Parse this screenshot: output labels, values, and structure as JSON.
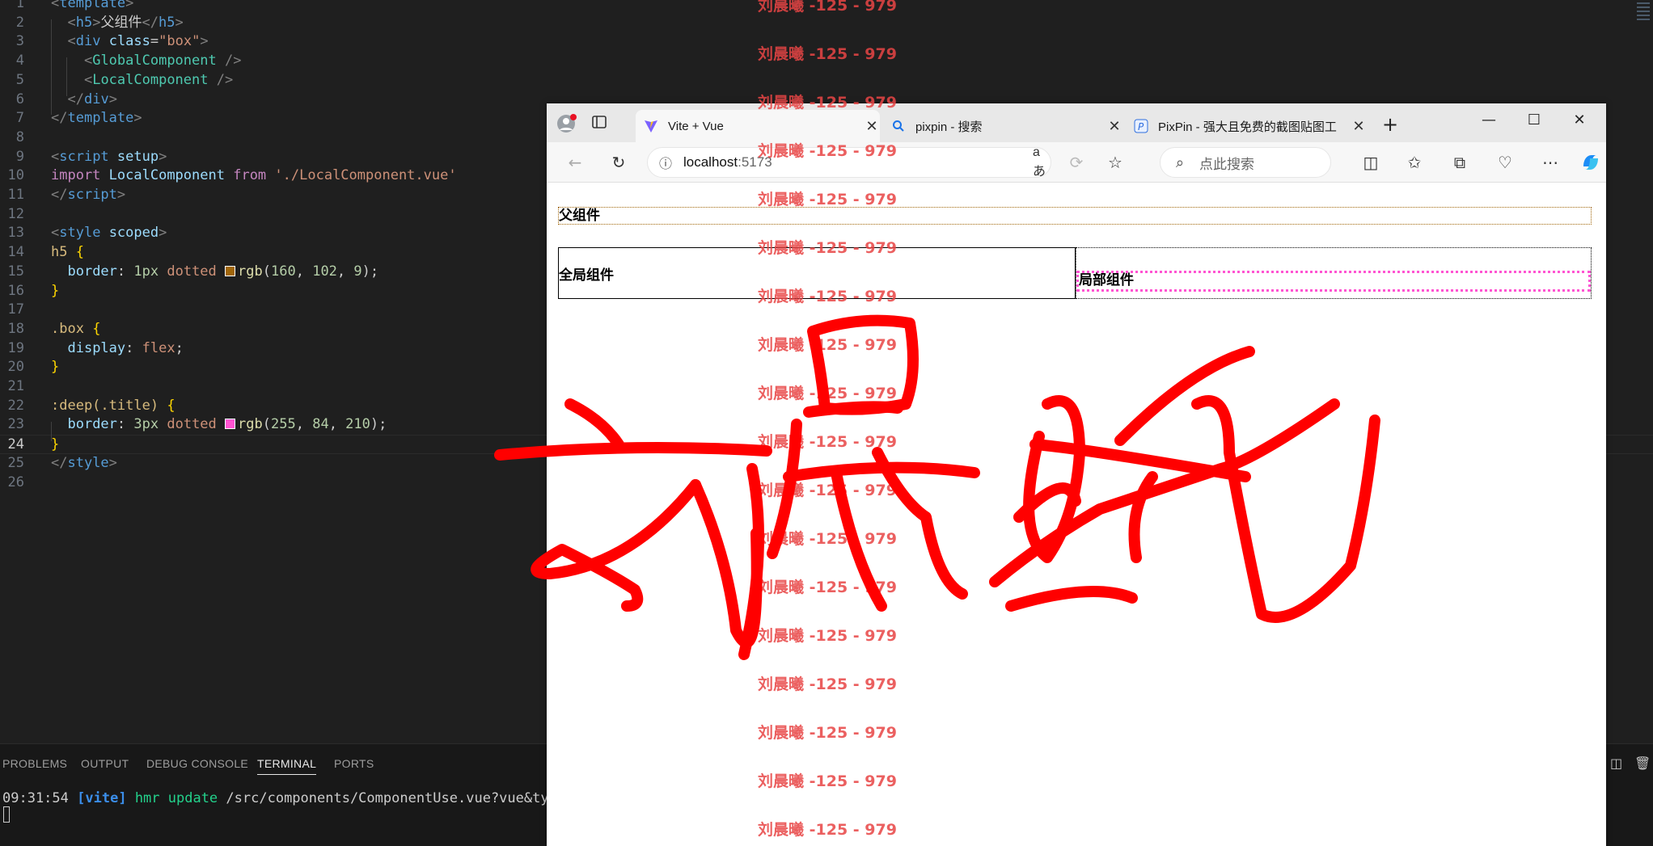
{
  "editor": {
    "lines": [
      {
        "n": "1",
        "html": [
          [
            "t-br",
            "<"
          ],
          [
            "t-tag",
            "template"
          ],
          [
            "t-br",
            ">"
          ]
        ]
      },
      {
        "n": "2",
        "html": [
          [
            "t-plain",
            "  "
          ],
          [
            "t-br",
            "<"
          ],
          [
            "t-tag",
            "h5"
          ],
          [
            "t-br",
            ">"
          ],
          [
            "t-plain",
            "父组件"
          ],
          [
            "t-br",
            "</"
          ],
          [
            "t-tag",
            "h5"
          ],
          [
            "t-br",
            ">"
          ]
        ]
      },
      {
        "n": "3",
        "html": [
          [
            "t-plain",
            "  "
          ],
          [
            "t-br",
            "<"
          ],
          [
            "t-tag",
            "div"
          ],
          [
            "t-plain",
            " "
          ],
          [
            "t-attr",
            "class"
          ],
          [
            "t-plain",
            "="
          ],
          [
            "t-str",
            "\"box\""
          ],
          [
            "t-br",
            ">"
          ]
        ]
      },
      {
        "n": "4",
        "html": [
          [
            "t-plain",
            "    "
          ],
          [
            "t-br",
            "<"
          ],
          [
            "t-comp",
            "GlobalComponent"
          ],
          [
            "t-plain",
            " "
          ],
          [
            "t-br",
            "/>"
          ]
        ]
      },
      {
        "n": "5",
        "html": [
          [
            "t-plain",
            "    "
          ],
          [
            "t-br",
            "<"
          ],
          [
            "t-comp",
            "LocalComponent"
          ],
          [
            "t-plain",
            " "
          ],
          [
            "t-br",
            "/>"
          ]
        ]
      },
      {
        "n": "6",
        "html": [
          [
            "t-plain",
            "  "
          ],
          [
            "t-br",
            "</"
          ],
          [
            "t-tag",
            "div"
          ],
          [
            "t-br",
            ">"
          ]
        ]
      },
      {
        "n": "7",
        "html": [
          [
            "t-br",
            "</"
          ],
          [
            "t-tag",
            "template"
          ],
          [
            "t-br",
            ">"
          ]
        ]
      },
      {
        "n": "8",
        "html": []
      },
      {
        "n": "9",
        "html": [
          [
            "t-br",
            "<"
          ],
          [
            "t-tag",
            "script"
          ],
          [
            "t-plain",
            " "
          ],
          [
            "t-attr",
            "setup"
          ],
          [
            "t-br",
            ">"
          ]
        ]
      },
      {
        "n": "10",
        "html": [
          [
            "t-kw",
            "import"
          ],
          [
            "t-plain",
            " "
          ],
          [
            "t-attr",
            "LocalComponent"
          ],
          [
            "t-plain",
            " "
          ],
          [
            "t-kw",
            "from"
          ],
          [
            "t-plain",
            " "
          ],
          [
            "t-str",
            "'./LocalComponent.vue'"
          ]
        ]
      },
      {
        "n": "11",
        "html": [
          [
            "t-br",
            "</"
          ],
          [
            "t-tag",
            "script"
          ],
          [
            "t-br",
            ">"
          ]
        ]
      },
      {
        "n": "12",
        "html": []
      },
      {
        "n": "13",
        "html": [
          [
            "t-br",
            "<"
          ],
          [
            "t-tag",
            "style"
          ],
          [
            "t-plain",
            " "
          ],
          [
            "t-attr",
            "scoped"
          ],
          [
            "t-br",
            ">"
          ]
        ]
      },
      {
        "n": "14",
        "html": [
          [
            "t-sel",
            "h5"
          ],
          [
            "t-plain",
            " "
          ],
          [
            "t-brace",
            "{"
          ]
        ]
      },
      {
        "n": "15",
        "html": [
          [
            "t-plain",
            "  "
          ],
          [
            "t-prop",
            "border"
          ],
          [
            "t-plain",
            ": "
          ],
          [
            "t-num",
            "1px"
          ],
          [
            "t-plain",
            " "
          ],
          [
            "t-val",
            "dotted"
          ],
          [
            "t-plain",
            " "
          ],
          [
            "swatch",
            "#a06609"
          ],
          [
            "t-fn",
            "rgb"
          ],
          [
            "t-plain",
            "("
          ],
          [
            "t-num",
            "160"
          ],
          [
            "t-plain",
            ", "
          ],
          [
            "t-num",
            "102"
          ],
          [
            "t-plain",
            ", "
          ],
          [
            "t-num",
            "9"
          ],
          [
            "t-plain",
            ");"
          ]
        ]
      },
      {
        "n": "16",
        "html": [
          [
            "t-brace",
            "}"
          ]
        ]
      },
      {
        "n": "17",
        "html": []
      },
      {
        "n": "18",
        "html": [
          [
            "t-sel",
            ".box"
          ],
          [
            "t-plain",
            " "
          ],
          [
            "t-brace",
            "{"
          ]
        ]
      },
      {
        "n": "19",
        "html": [
          [
            "t-plain",
            "  "
          ],
          [
            "t-prop",
            "display"
          ],
          [
            "t-plain",
            ": "
          ],
          [
            "t-val",
            "flex"
          ],
          [
            "t-plain",
            ";"
          ]
        ]
      },
      {
        "n": "20",
        "html": [
          [
            "t-brace",
            "}"
          ]
        ]
      },
      {
        "n": "21",
        "html": []
      },
      {
        "n": "22",
        "html": [
          [
            "t-sel",
            ":deep(.title)"
          ],
          [
            "t-plain",
            " "
          ],
          [
            "t-brace",
            "{"
          ]
        ]
      },
      {
        "n": "23",
        "html": [
          [
            "t-plain",
            "  "
          ],
          [
            "t-prop",
            "border"
          ],
          [
            "t-plain",
            ": "
          ],
          [
            "t-num",
            "3px"
          ],
          [
            "t-plain",
            " "
          ],
          [
            "t-val",
            "dotted"
          ],
          [
            "t-plain",
            " "
          ],
          [
            "swatch",
            "#ff54d2"
          ],
          [
            "t-fn",
            "rgb"
          ],
          [
            "t-plain",
            "("
          ],
          [
            "t-num",
            "255"
          ],
          [
            "t-plain",
            ", "
          ],
          [
            "t-num",
            "84"
          ],
          [
            "t-plain",
            ", "
          ],
          [
            "t-num",
            "210"
          ],
          [
            "t-plain",
            ");"
          ]
        ]
      },
      {
        "n": "24",
        "html": [
          [
            "t-brace",
            "}"
          ]
        ]
      },
      {
        "n": "25",
        "html": [
          [
            "t-br",
            "</"
          ],
          [
            "t-tag",
            "style"
          ],
          [
            "t-br",
            ">"
          ]
        ]
      },
      {
        "n": "26",
        "html": []
      }
    ],
    "active_line": "24"
  },
  "panel": {
    "tabs": [
      "PROBLEMS",
      "OUTPUT",
      "DEBUG CONSOLE",
      "TERMINAL",
      "PORTS"
    ],
    "active_tab": "TERMINAL",
    "terminal": {
      "time": "09:31:54",
      "tag": "[vite]",
      "event": "hmr update",
      "path": "/src/components/ComponentUse.vue?vue&type=style&"
    }
  },
  "browser": {
    "tabs": [
      {
        "title": "Vite + Vue",
        "active": true
      },
      {
        "title": "pixpin - 搜索",
        "active": false
      },
      {
        "title": "PixPin - 强大且免费的截图贴图工",
        "active": false
      }
    ],
    "address": {
      "host": "localhost",
      "port": ":5173"
    },
    "search_placeholder": "点此搜索",
    "read_aloud": "aあ",
    "page": {
      "h5": "父组件",
      "global": "全局组件",
      "local": "局部组件"
    }
  },
  "watermark": {
    "text": "刘晨曦 -125 - 979",
    "count": 18
  },
  "colors": {
    "editor_bg": "#1f1f1f",
    "h5_border": "#a06609",
    "title_border": "#ff54d2",
    "signature": "#ff0000"
  }
}
